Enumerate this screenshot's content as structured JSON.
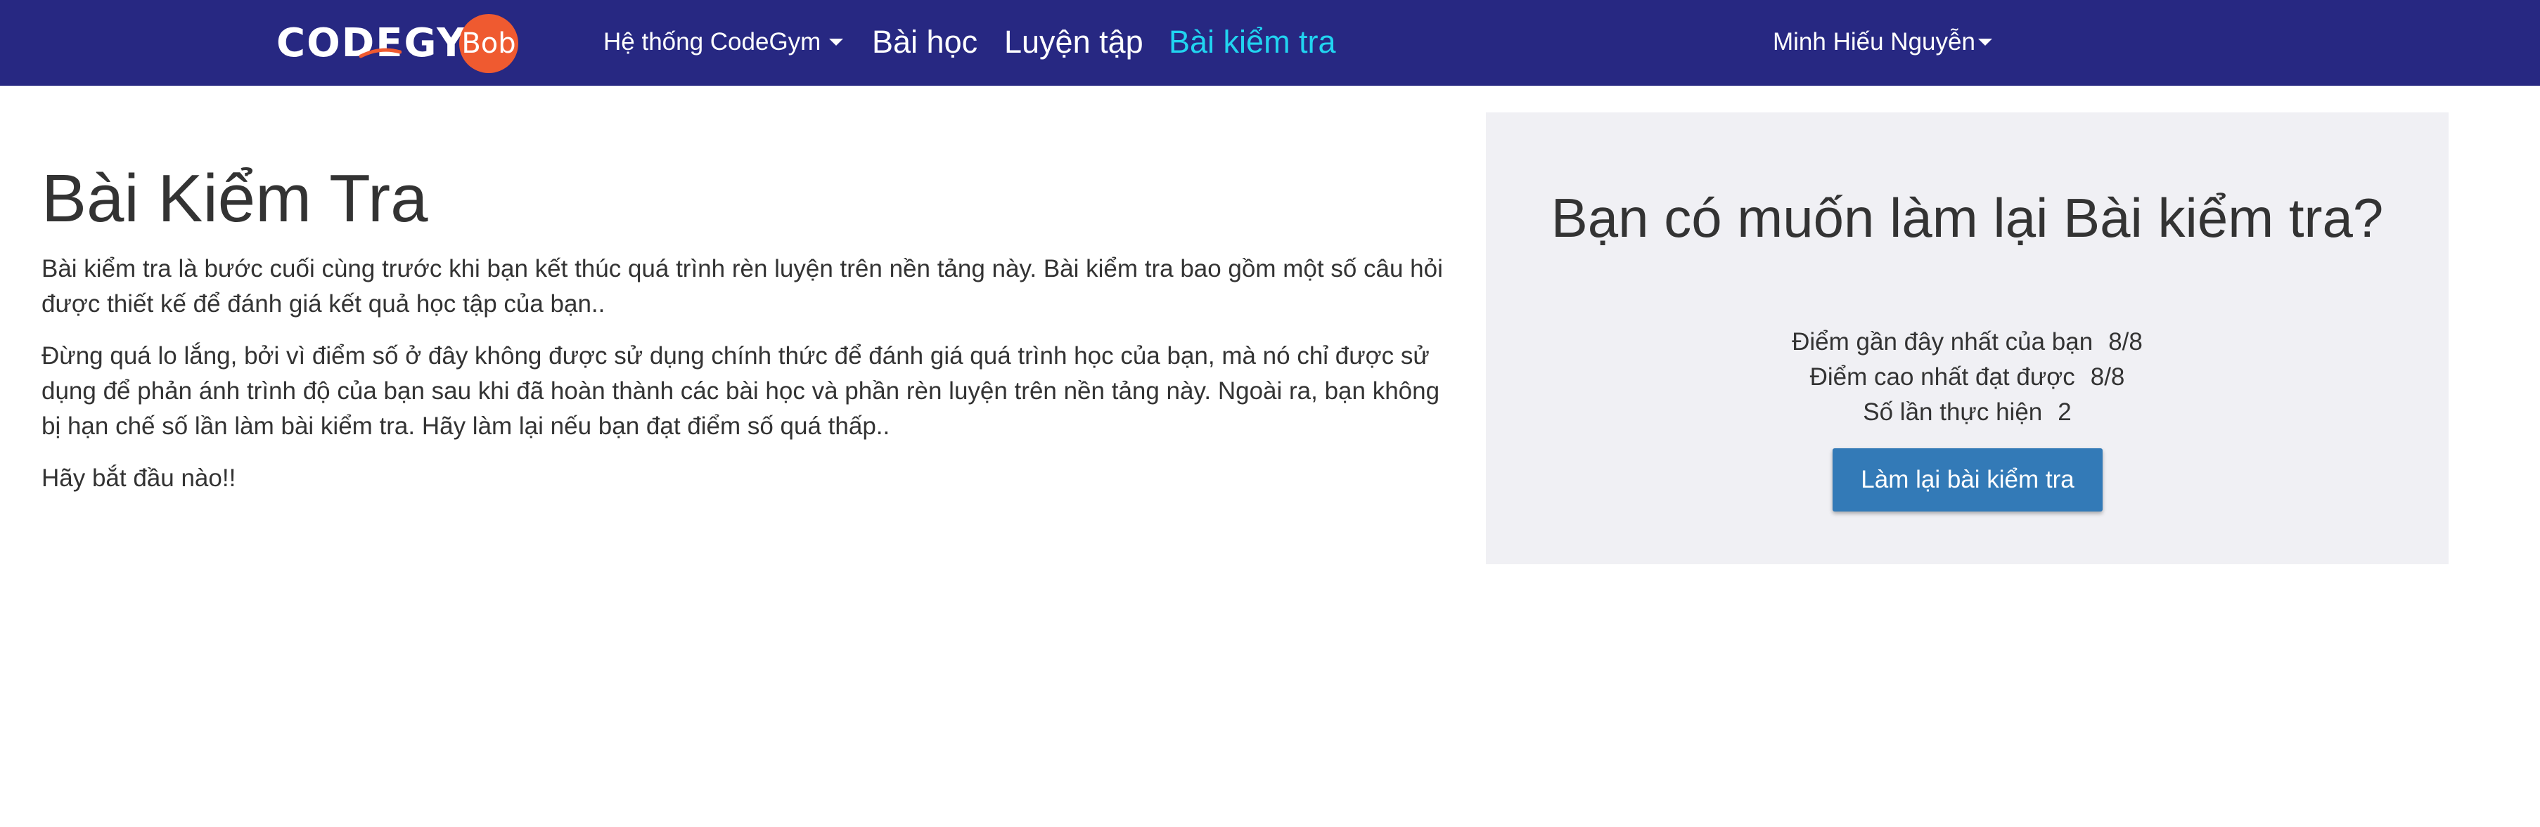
{
  "brand": {
    "logo_text": "CODEGYM",
    "logo_badge": "Bob",
    "colors": {
      "navbar": "#272882",
      "active_link": "#21d4f0",
      "badge": "#ef5a30",
      "button": "#337ab7",
      "panel": "#f0f0f4"
    }
  },
  "nav": {
    "system_label": "Hệ thống CodeGym",
    "lessons_label": "Bài học",
    "practice_label": "Luyện tập",
    "test_label": "Bài kiểm tra",
    "user_name": "Minh Hiếu Nguyễn"
  },
  "main": {
    "title": "Bài Kiểm Tra",
    "paragraphs": [
      "Bài kiểm tra là bước cuối cùng trước khi bạn kết thúc quá trình rèn luyện trên nền tảng này. Bài kiểm tra bao gồm một số câu hỏi được thiết kế để đánh giá kết quả học tập của bạn..",
      "Đừng quá lo lắng, bởi vì điểm số ở đây không được sử dụng chính thức để đánh giá quá trình học của bạn, mà nó chỉ được sử dụng để phản ánh trình độ của bạn sau khi đã hoàn thành các bài học và phần rèn luyện trên nền tảng này. Ngoài ra, bạn không bị hạn chế số lần làm bài kiểm tra. Hãy làm lại nếu bạn đạt điểm số quá thấp..",
      "Hãy bắt đầu nào!!"
    ]
  },
  "panel": {
    "title": "Bạn có muốn làm lại Bài kiểm tra?",
    "stats": [
      {
        "label": "Điểm gần đây nhất của bạn",
        "value": "8/8"
      },
      {
        "label": "Điểm cao nhất đạt được",
        "value": "8/8"
      },
      {
        "label": "Số lần thực hiện",
        "value": "2"
      }
    ],
    "retry_label": "Làm lại bài kiểm tra"
  }
}
